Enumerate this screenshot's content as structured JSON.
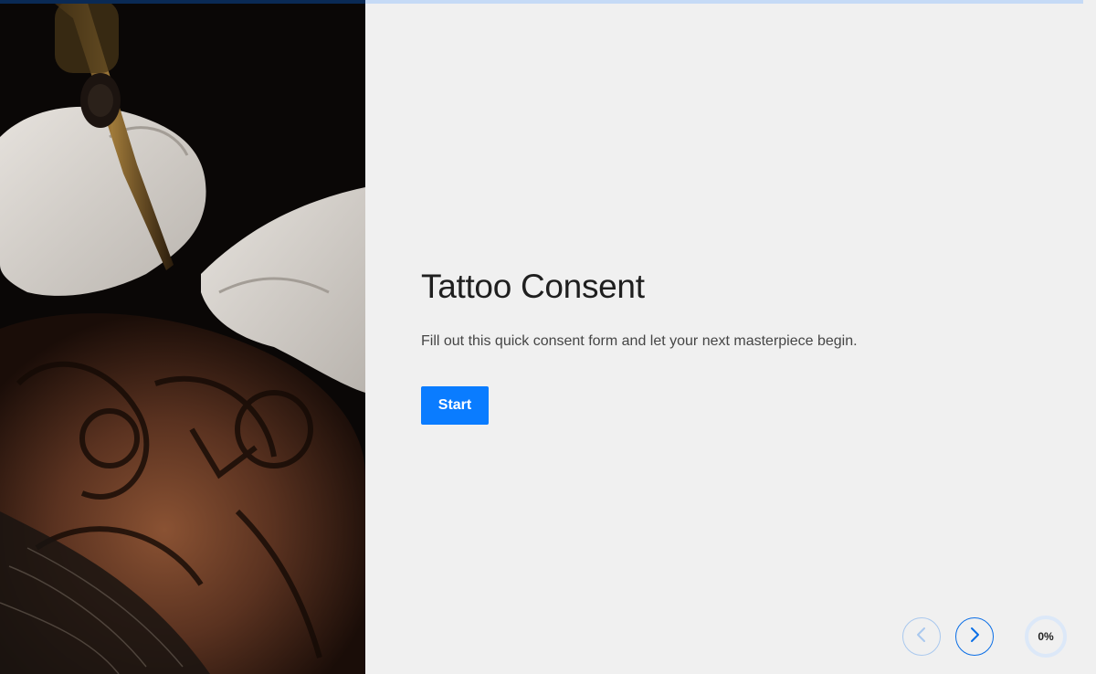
{
  "header": {
    "progress_bar_fraction": 0.0
  },
  "intro": {
    "title": "Tattoo Consent",
    "subtitle": "Fill out this quick consent form and let your next masterpiece begin.",
    "start_label": "Start"
  },
  "image": {
    "description": "tattoo artist gloved hands tattooing a sleeve"
  },
  "navigation": {
    "prev_icon": "chevron-left-icon",
    "next_icon": "chevron-right-icon"
  },
  "progress": {
    "value": 0,
    "label": "0%"
  },
  "colors": {
    "accent": "#0a7cff",
    "background": "#f0f0f0",
    "title": "#1f1f1f",
    "progress_ring": "#dce8f8"
  }
}
